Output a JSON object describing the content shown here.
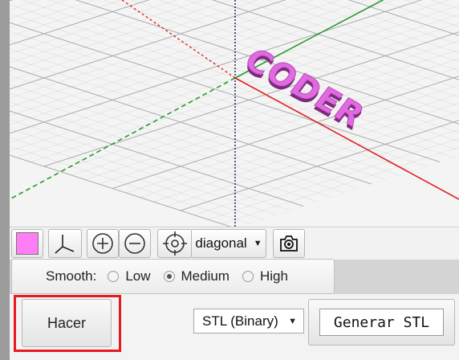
{
  "viewport": {
    "model_text": "CODER",
    "model_color": "#e06ae0",
    "axis_colors": {
      "x": "#e02020",
      "y": "#2a8a2a",
      "z": "#2a2a7a"
    }
  },
  "toolbar": {
    "color_swatch": "#ff7df5",
    "axes_icon": "axes-icon",
    "zoom_in_icon": "zoom-in-icon",
    "zoom_out_icon": "zoom-out-icon",
    "target_icon": "crosshair-icon",
    "view_select": "diagonal",
    "camera_icon": "camera-icon"
  },
  "smooth": {
    "label": "Smooth:",
    "options": [
      {
        "label": "Low",
        "checked": false
      },
      {
        "label": "Medium",
        "checked": true
      },
      {
        "label": "High",
        "checked": false
      }
    ]
  },
  "actions": {
    "make_label": "Hacer",
    "format_select": "STL (Binary)",
    "generate_label": "Generar STL"
  }
}
